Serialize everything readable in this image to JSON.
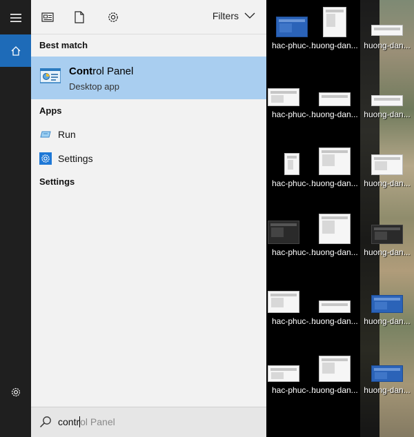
{
  "rail": {
    "menu_icon": "hamburger-icon",
    "home_icon": "home-icon",
    "settings_icon": "gear-icon"
  },
  "topbar": {
    "icons": [
      "news-icon",
      "document-icon",
      "gear-icon"
    ],
    "filters_label": "Filters"
  },
  "best_match": {
    "heading": "Best match",
    "title_bold": "Cont",
    "title_rest": "rol Panel",
    "subtitle": "Desktop app"
  },
  "apps": {
    "heading": "Apps",
    "items": [
      {
        "label": "Run",
        "icon": "run-icon"
      },
      {
        "label": "Settings",
        "icon": "gear-icon"
      }
    ]
  },
  "settings_section": {
    "heading": "Settings"
  },
  "search": {
    "typed": "contr",
    "suggestion_rest": "ol Panel"
  },
  "desktop": {
    "captions": [
      "hac-phuc-...",
      "huong-dan...",
      "huong-dan..."
    ]
  },
  "colors": {
    "accent": "#1e6bb8",
    "highlight": "#a9cef0",
    "panel_bg": "#f2f2f2"
  }
}
